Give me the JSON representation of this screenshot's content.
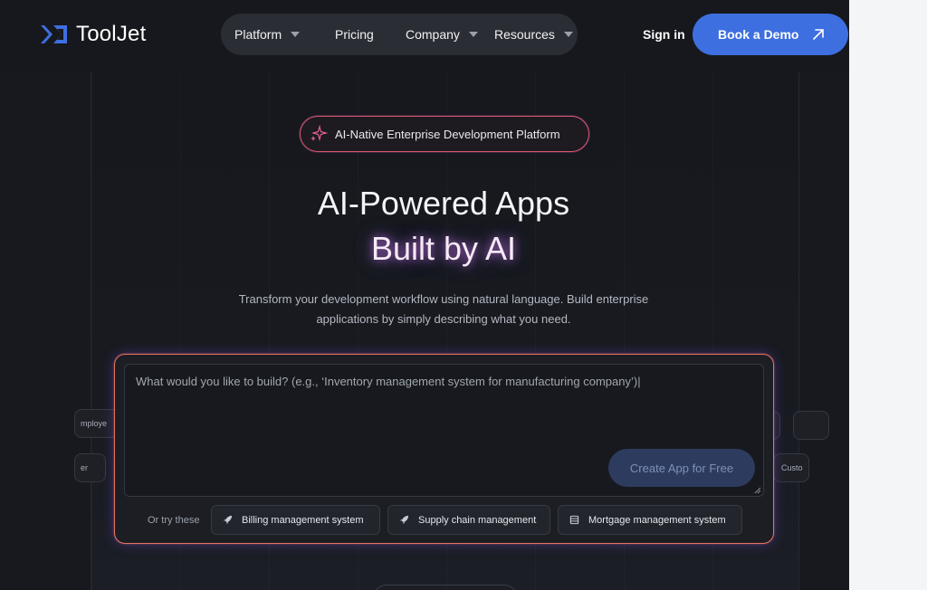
{
  "header": {
    "logo_text": "ToolJet",
    "nav": [
      {
        "label": "Platform",
        "has_dropdown": true
      },
      {
        "label": "Pricing",
        "has_dropdown": false
      },
      {
        "label": "Company",
        "has_dropdown": true
      },
      {
        "label": "Resources",
        "has_dropdown": true
      }
    ],
    "signin_label": "Sign in",
    "demo_label": "Book a Demo"
  },
  "hero": {
    "badge": "AI-Native Enterprise Development Platform",
    "title_line1": "AI-Powered Apps",
    "title_line2": "Built by AI",
    "subtitle": "Transform your development workflow using natural language. Build enterprise applications by simply describing what you need."
  },
  "prompt": {
    "placeholder": "What would you like to build? (e.g., ‘Inventory management system for manufacturing company’)|",
    "create_label": "Create App for Free",
    "try_label": "Or try these",
    "suggestions": [
      {
        "label": "Billing management system",
        "icon": "rocket-icon"
      },
      {
        "label": "Supply chain management",
        "icon": "rocket-icon"
      },
      {
        "label": "Mortgage management system",
        "icon": "table-icon"
      }
    ]
  },
  "side_chips": {
    "left_top": "mploye",
    "left_bottom": "er",
    "right_bottom": "Custo"
  },
  "colors": {
    "accent": "#3e6fe0",
    "background": "#17191e",
    "badge_border": "#d5586e",
    "card_border": "#e5735f"
  }
}
